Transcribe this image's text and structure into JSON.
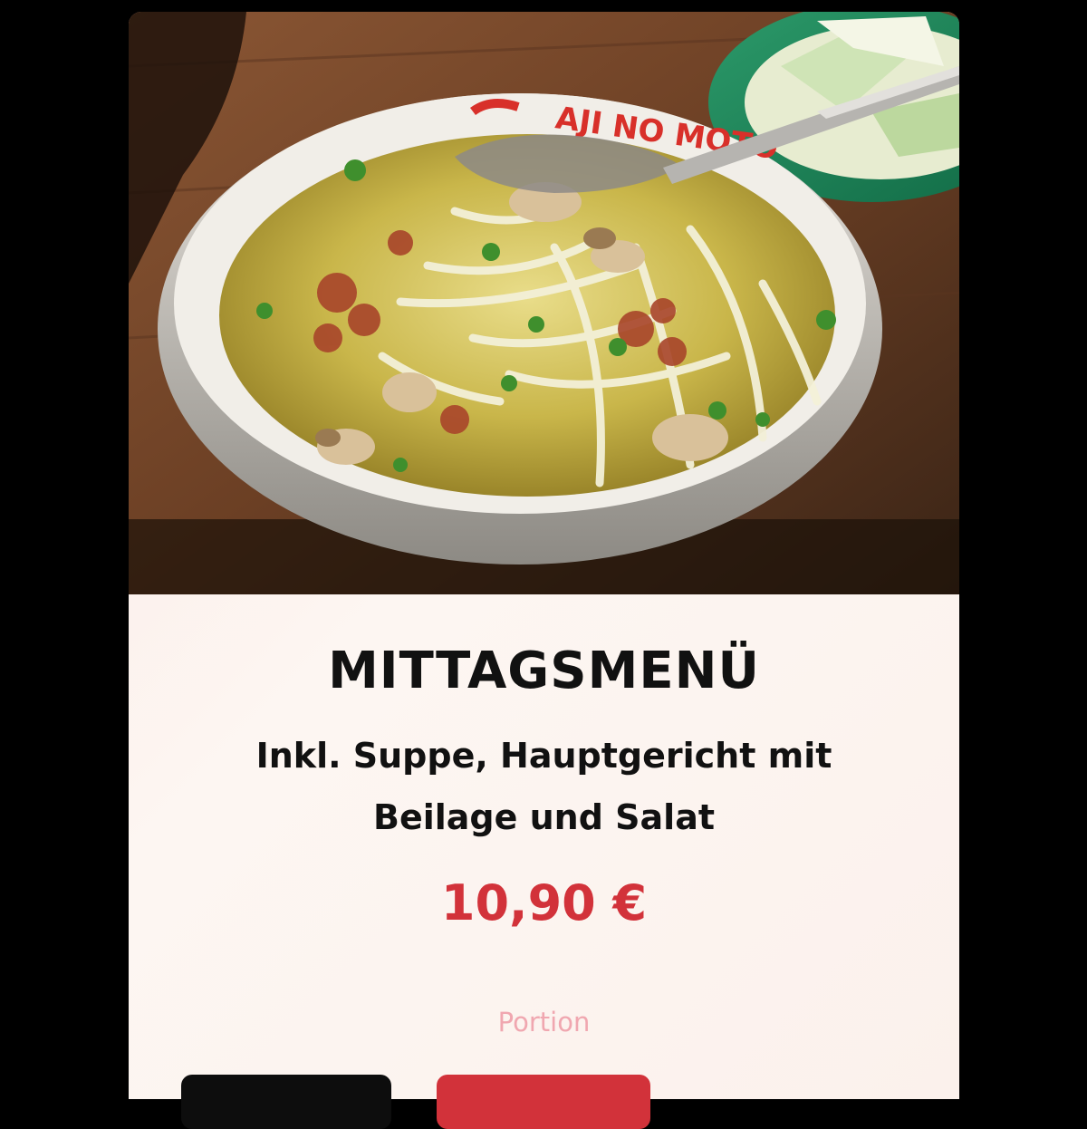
{
  "menu_item": {
    "title": "MITTAGSMENÜ",
    "description": "Inkl. Suppe, Hauptgericht mit Beilage und Salat",
    "price": "10,90 €",
    "portion_label": "Portion"
  },
  "photo": {
    "subject": "soup-bowl-with-noodles-and-herbs",
    "bowl_rim_text": "AJI NO MOTO"
  },
  "colors": {
    "background": "#000000",
    "price_accent": "#d2323a",
    "portion_label": "#f0a7b0",
    "button_dark": "#0d0d0d",
    "button_red": "#d2323a"
  }
}
